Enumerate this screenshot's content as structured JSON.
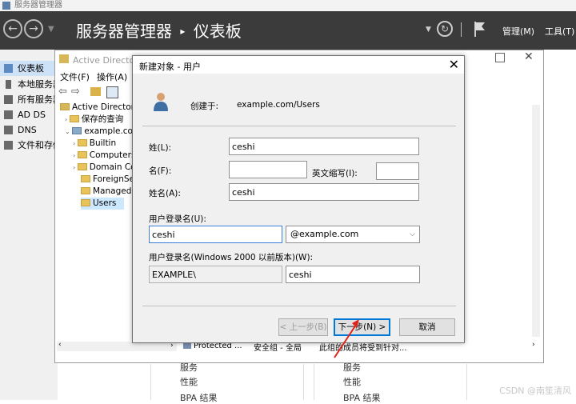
{
  "window": {
    "title": "服务器管理器"
  },
  "header": {
    "title": "服务器管理器",
    "separator": "▸",
    "page": "仪表板",
    "manage": "管理(M)",
    "tools": "工具(T)"
  },
  "leftnav": {
    "items": [
      {
        "label": "仪表板",
        "selected": true,
        "icon": "dashboard-icon"
      },
      {
        "label": "本地服务器",
        "icon": "server-icon"
      },
      {
        "label": "所有服务器",
        "icon": "servers-icon"
      },
      {
        "label": "AD DS",
        "icon": "adds-icon"
      },
      {
        "label": "DNS",
        "icon": "dns-icon"
      },
      {
        "label": "文件和存储服务",
        "icon": "storage-icon"
      }
    ]
  },
  "aduc": {
    "title": "Active Directory 用户和计算机",
    "menu": {
      "file": "文件(F)",
      "action": "操作(A)"
    },
    "tree": {
      "root": "Active Directory",
      "saved": "保存的查询",
      "domain": "example.com",
      "children": [
        "Builtin",
        "Computers",
        "Domain Controllers",
        "ForeignSecurityPrincipals",
        "Managed Service Accounts",
        "Users"
      ]
    },
    "status": {
      "protected": "Protected ...",
      "group": "安全组 - 全局",
      "desc": "此组的成员将受到针对..."
    }
  },
  "dialog": {
    "title": "新建对象 - 用户",
    "create_in_label": "创建于:",
    "create_in_value": "example.com/Users",
    "surname_label": "姓(L):",
    "surname_value": "ceshi",
    "given_label": "名(F):",
    "given_value": "",
    "initials_label": "英文缩写(I):",
    "initials_value": "",
    "fullname_label": "姓名(A):",
    "fullname_value": "ceshi",
    "logon_label": "用户登录名(U):",
    "logon_value": "ceshi",
    "domain_option": "@example.com",
    "pre2000_label": "用户登录名(Windows 2000 以前版本)(W):",
    "pre2000_domain": "EXAMPLE\\",
    "pre2000_name": "ceshi",
    "back_button": "< 上一步(B)",
    "next_button": "下一步(N) >",
    "cancel_button": "取消"
  },
  "bottom": {
    "left": [
      "服务",
      "性能",
      "BPA 结果"
    ],
    "right": [
      "服务",
      "性能",
      "BPA 结果"
    ]
  },
  "watermark": "CSDN @南笙清风",
  "colors": {
    "header_bg": "#3b3b3b",
    "selected": "#cde1f7",
    "accent": "#0078d7",
    "arrow": "#e0241b"
  }
}
